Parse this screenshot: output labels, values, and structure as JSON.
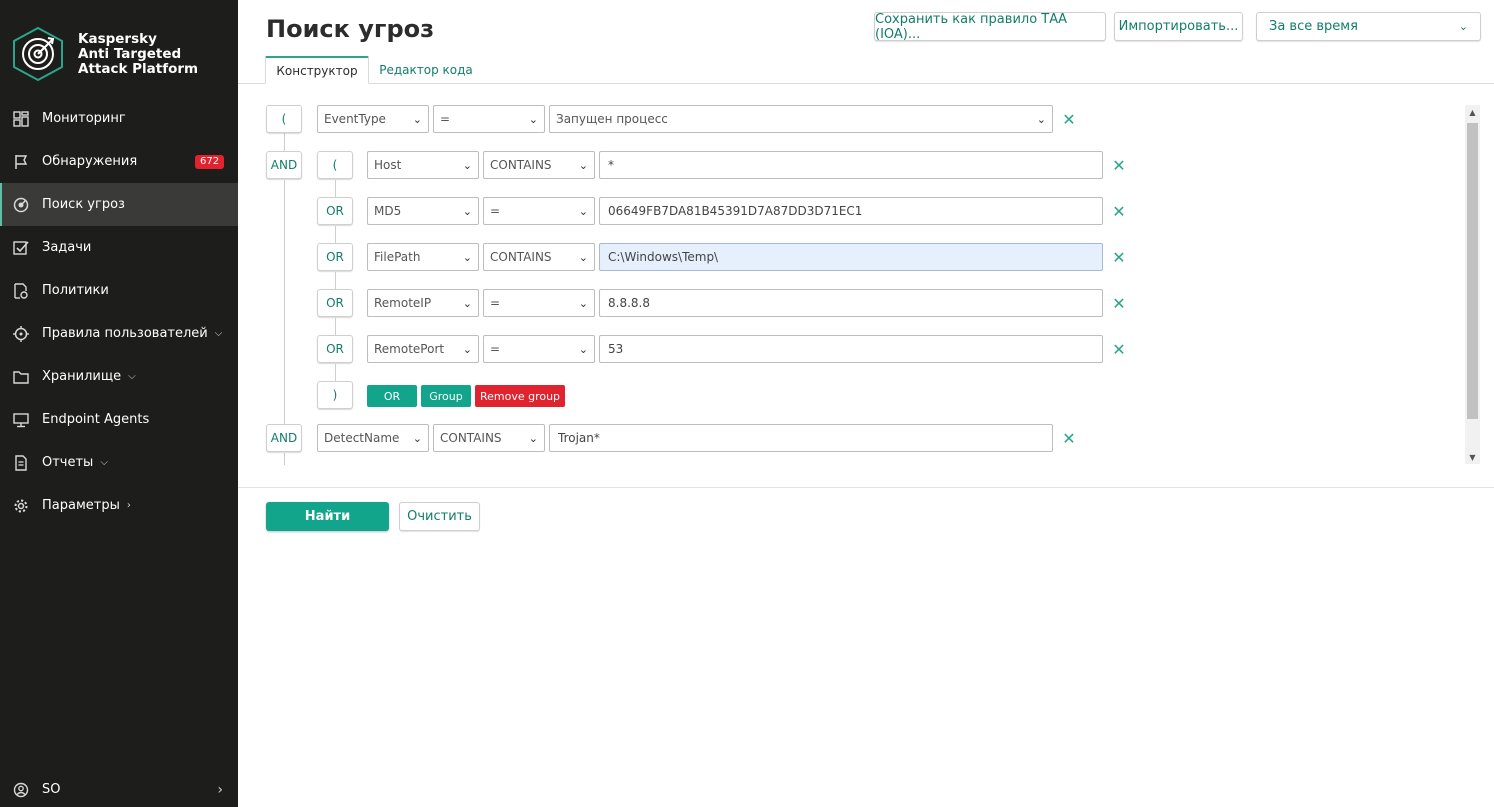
{
  "brand": {
    "line1": "Kaspersky",
    "line2": "Anti Targeted",
    "line3": "Attack Platform",
    "accent": "#2aa58b"
  },
  "sidebar": {
    "items": [
      {
        "label": "Мониторинг",
        "icon": "dashboard-icon"
      },
      {
        "label": "Обнаружения",
        "icon": "flag-icon",
        "badge": "672"
      },
      {
        "label": "Поиск угроз",
        "icon": "threat-search-icon",
        "active": true
      },
      {
        "label": "Задачи",
        "icon": "tasks-icon"
      },
      {
        "label": "Политики",
        "icon": "policies-icon"
      },
      {
        "label": "Правила пользователей",
        "icon": "crosshair-icon",
        "expandable": true
      },
      {
        "label": "Хранилище",
        "icon": "folder-icon",
        "expandable": true
      },
      {
        "label": "Endpoint Agents",
        "icon": "monitor-icon"
      },
      {
        "label": "Отчеты",
        "icon": "report-icon",
        "expandable": true
      },
      {
        "label": "Параметры",
        "icon": "gear-icon",
        "expandable": true
      }
    ],
    "user": "SO"
  },
  "header": {
    "title": "Поиск угроз",
    "save_rule": "Сохранить как правило ТАА (IOA)...",
    "import": "Импортировать...",
    "period": "За все время"
  },
  "tabs": {
    "builder": "Конструктор",
    "code": "Редактор кода"
  },
  "query": {
    "row1": {
      "open": "(",
      "field": "EventType",
      "op": "=",
      "value": "Запущен процесс"
    },
    "group": {
      "join": "AND",
      "open": "(",
      "rows": [
        {
          "field": "Host",
          "op": "CONTAINS",
          "value": "*"
        },
        {
          "join": "OR",
          "field": "MD5",
          "op": "=",
          "value": "06649FB7DA81B45391D7A87DD3D71EC1"
        },
        {
          "join": "OR",
          "field": "FilePath",
          "op": "CONTAINS",
          "value": "C:\\Windows\\Temp\\"
        },
        {
          "join": "OR",
          "field": "RemoteIP",
          "op": "=",
          "value": "8.8.8.8"
        },
        {
          "join": "OR",
          "field": "RemotePort",
          "op": "=",
          "value": "53"
        }
      ],
      "close": ")",
      "add_or": "OR",
      "add_group": "Group",
      "remove_group": "Remove group"
    },
    "row_last": {
      "join": "AND",
      "field": "DetectName",
      "op": "CONTAINS",
      "value": "Trojan*"
    }
  },
  "actions": {
    "find": "Найти",
    "clear": "Очистить"
  },
  "colors": {
    "primary": "#13a58b",
    "danger": "#e0232e",
    "sidebar": "#1d1d1b"
  }
}
